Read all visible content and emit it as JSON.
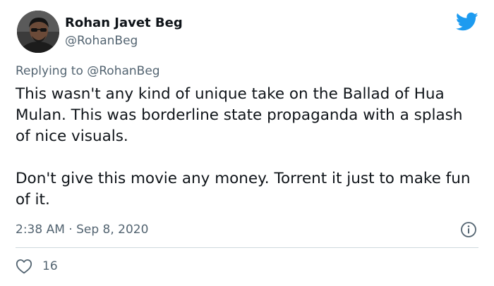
{
  "tweet": {
    "author_name": "Rohan Javet Beg",
    "author_handle": "@RohanBeg",
    "replying_prefix": "Replying to",
    "replying_to": "@RohanBeg",
    "paragraphs": [
      "This wasn't any kind of unique take on the Ballad of Hua Mulan. This was borderline state propaganda with a splash of nice visuals.",
      "Don't give this movie any money. Torrent it just to make fun of it."
    ],
    "timestamp": "2:38 AM · Sep 8, 2020",
    "like_count": "16"
  },
  "icons": {
    "brand": "twitter-bird-icon",
    "info": "info-icon",
    "like": "heart-icon"
  },
  "colors": {
    "twitter_blue": "#1d9bf0",
    "secondary_text": "#536471",
    "primary_text": "#0f1419",
    "divider": "#cfd9de"
  }
}
